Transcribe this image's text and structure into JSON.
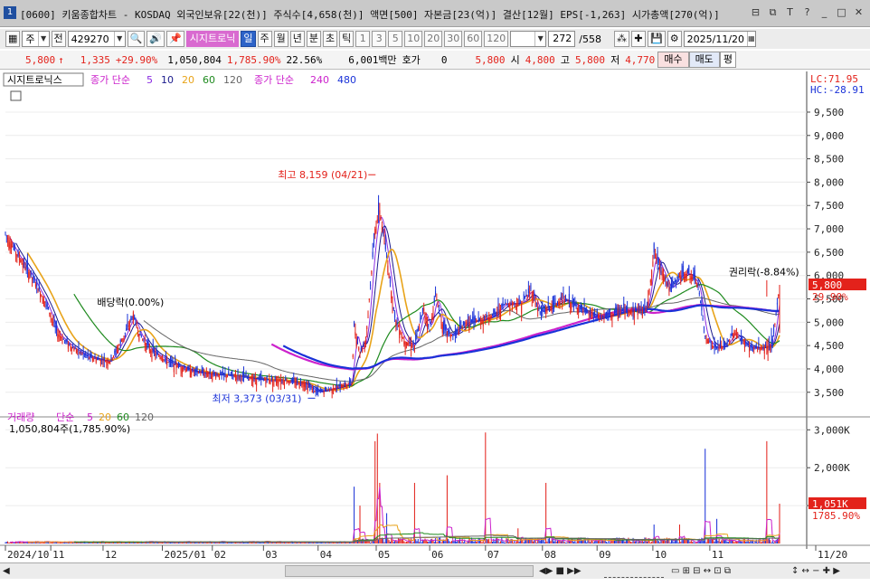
{
  "window": {
    "app_number": "1",
    "title": "[0600] 키움종합차트 - KOSDAQ 외국인보유[22(천)] 주식수[4,658(천)] 액면[500] 자본금[23(억)] 결산[12월] EPS[-1,263] 시가총액[270(억)]",
    "buttons": [
      "⊟",
      "⧉",
      "T",
      "?",
      "_",
      "□",
      "✕"
    ]
  },
  "toolbar": {
    "period_primary": "주",
    "market": "전",
    "code": "429270",
    "indicator_button": "시지트로닉",
    "periods": [
      "일",
      "주",
      "월",
      "년",
      "분",
      "초",
      "틱"
    ],
    "active_period": "일",
    "intervals": [
      "1",
      "3",
      "5",
      "10",
      "20",
      "30",
      "60",
      "120"
    ],
    "range": "272",
    "range_total": "/558",
    "date": "2025/11/20"
  },
  "quote": {
    "price": "5,800",
    "arrow": "↑",
    "change": "1,335",
    "change_pct": "+29.90%",
    "volume": "1,050,804",
    "volume_pct": "1,785.90%",
    "turnover": "22.56%",
    "amount": "6,001백만",
    "hoga_label": "호가",
    "hoga_value": "0",
    "hoga_price": "5,800",
    "open_label": "시",
    "open": "4,800",
    "high_label": "고",
    "high": "5,800",
    "low_label": "저",
    "low": "4,770",
    "buy": "매수",
    "sell": "매도",
    "pl": "평"
  },
  "chart_data": {
    "type": "candlestick",
    "price_legend": {
      "name": "시지트로닉스",
      "ma_label": "종가 단순",
      "ma_periods": [
        "5",
        "10",
        "20",
        "60",
        "120"
      ],
      "ma_colors": [
        "#8a2be2",
        "#1a1a8c",
        "#e8a319",
        "#1e8a1e",
        "#666666"
      ],
      "long_ma_label": "종가 단순",
      "long_ma_periods": [
        "240",
        "480"
      ],
      "long_ma_colors": [
        "#cc22cc",
        "#1a32d8"
      ]
    },
    "lc_label": "LC:71.95",
    "hc_label": "HC:-28.91",
    "price_axis": {
      "ticks": [
        3500,
        4000,
        4500,
        5000,
        5500,
        6000,
        6500,
        7000,
        7500,
        8000,
        8500,
        9000,
        9500
      ],
      "tick_labels": [
        "3,500",
        "4,000",
        "4,500",
        "5,000",
        "5,500",
        "6,000",
        "6,500",
        "7,000",
        "7,500",
        "8,000",
        "8,500",
        "9,000",
        "9,500"
      ],
      "ylim": [
        3050,
        10100
      ]
    },
    "current_price_label": "5,800",
    "current_pct_label": "29.90%",
    "annotations": {
      "high": "최고 8,159 (04/21)",
      "low": "최저 3,373 (03/31)",
      "dividend": "배당락(0.00%)",
      "rights": "권리락(-8.84%)"
    },
    "volume_legend": {
      "name": "거래량",
      "ma_label": "단순",
      "ma_periods": [
        "5",
        "20",
        "60",
        "120"
      ],
      "ma_colors": [
        "#cc22cc",
        "#e8a319",
        "#1e8a1e",
        "#666666"
      ],
      "current": "1,050,804주(1,785.90%)"
    },
    "volume_axis": {
      "ticks": [
        1000,
        2000,
        3000
      ],
      "tick_labels": [
        "1,000K",
        "2,000K",
        "3,000K"
      ],
      "ylim": [
        0,
        3150
      ]
    },
    "current_volume_label": "1,051K",
    "current_volume_pct_label": "1785.90%",
    "x_axis_labels": [
      "2024/10",
      "11",
      "12",
      "2025/01",
      "02",
      "03",
      "04",
      "05",
      "06",
      "07",
      "08",
      "09",
      "10",
      "11",
      "11/20"
    ],
    "close_anchors": [
      [
        0,
        6900
      ],
      [
        10,
        6450
      ],
      [
        22,
        6000
      ],
      [
        35,
        5400
      ],
      [
        45,
        4750
      ],
      [
        58,
        4450
      ],
      [
        72,
        4250
      ],
      [
        80,
        4200
      ],
      [
        90,
        4150
      ],
      [
        100,
        4600
      ],
      [
        110,
        5150
      ],
      [
        115,
        4750
      ],
      [
        125,
        4400
      ],
      [
        140,
        4150
      ],
      [
        160,
        3950
      ],
      [
        180,
        3880
      ],
      [
        200,
        3850
      ],
      [
        215,
        3780
      ],
      [
        240,
        3750
      ],
      [
        258,
        3680
      ],
      [
        268,
        3500
      ],
      [
        285,
        3600
      ],
      [
        298,
        3700
      ],
      [
        300,
        4900
      ],
      [
        305,
        4350
      ],
      [
        310,
        4600
      ],
      [
        318,
        7000
      ],
      [
        322,
        7400
      ],
      [
        328,
        6400
      ],
      [
        335,
        5100
      ],
      [
        343,
        4600
      ],
      [
        352,
        4500
      ],
      [
        360,
        5300
      ],
      [
        365,
        4800
      ],
      [
        370,
        5600
      ],
      [
        377,
        4850
      ],
      [
        385,
        4700
      ],
      [
        397,
        5000
      ],
      [
        410,
        5050
      ],
      [
        420,
        5150
      ],
      [
        430,
        5400
      ],
      [
        444,
        5400
      ],
      [
        452,
        5700
      ],
      [
        460,
        5200
      ],
      [
        470,
        5350
      ],
      [
        480,
        5500
      ],
      [
        490,
        5350
      ],
      [
        500,
        5200
      ],
      [
        510,
        5100
      ],
      [
        520,
        5150
      ],
      [
        530,
        5250
      ],
      [
        540,
        5250
      ],
      [
        552,
        5300
      ],
      [
        558,
        6500
      ],
      [
        565,
        6100
      ],
      [
        572,
        5700
      ],
      [
        580,
        6000
      ],
      [
        588,
        6050
      ],
      [
        596,
        5800
      ],
      [
        602,
        4700
      ],
      [
        610,
        4450
      ],
      [
        620,
        4500
      ],
      [
        627,
        4800
      ],
      [
        633,
        4600
      ],
      [
        642,
        4450
      ],
      [
        652,
        4450
      ],
      [
        660,
        4550
      ],
      [
        666,
        5800
      ]
    ],
    "volume_spikes": [
      [
        300,
        1500
      ],
      [
        305,
        1000
      ],
      [
        318,
        2700
      ],
      [
        320,
        2900
      ],
      [
        322,
        1600
      ],
      [
        328,
        800
      ],
      [
        352,
        1600
      ],
      [
        380,
        1800
      ],
      [
        413,
        2930
      ],
      [
        441,
        400
      ],
      [
        465,
        1600
      ],
      [
        558,
        500
      ],
      [
        580,
        500
      ],
      [
        602,
        2500
      ],
      [
        612,
        650
      ],
      [
        655,
        2700
      ],
      [
        666,
        1051
      ]
    ]
  }
}
